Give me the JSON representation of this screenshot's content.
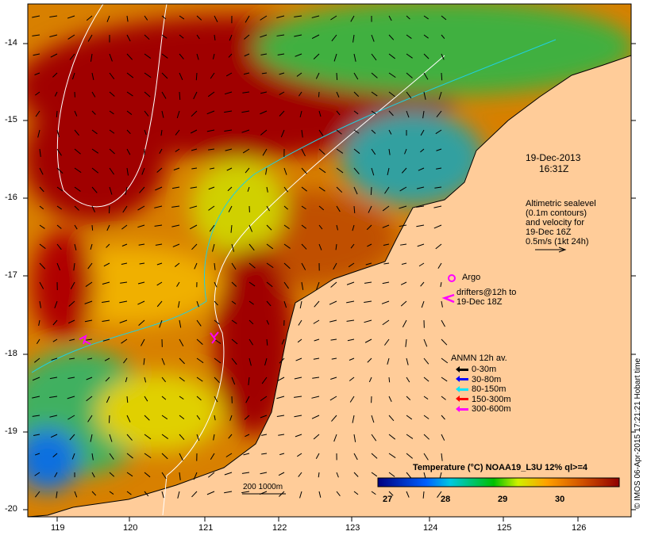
{
  "map": {
    "x_ticks": [
      "119",
      "120",
      "121",
      "122",
      "123",
      "124",
      "125",
      "126"
    ],
    "y_ticks": [
      "-14",
      "-15",
      "-16",
      "-17",
      "-18",
      "-19",
      "-20"
    ],
    "date": "19-Dec-2013",
    "time": "16:31Z",
    "altimetry": [
      "Altimetric sealevel",
      "(0.1m contours)",
      "and velocity for",
      "19-Dec 16Z",
      "0.5m/s (1kt 24h)"
    ],
    "argo_label": "Argo",
    "drifters_label": [
      "drifters@12h to",
      "19-Dec 18Z"
    ],
    "anmn_title": "ANMN 12h av.",
    "anmn_legend": [
      {
        "label": "0-30m",
        "color": "#000000"
      },
      {
        "label": "30-80m",
        "color": "#0000ff"
      },
      {
        "label": "80-150m",
        "color": "#00e5ff"
      },
      {
        "label": "150-300m",
        "color": "#ff0000"
      },
      {
        "label": "300-600m",
        "color": "#ff00ff"
      }
    ],
    "isobath_label": "200  1000m",
    "colorbar": {
      "title": "Temperature (°C) NOAA19_L3U 12% ql>=4",
      "ticks": [
        "27",
        "28",
        "29",
        "30"
      ],
      "range": [
        26.8,
        31.0
      ],
      "colors": [
        "#000080",
        "#0050ff",
        "#00c8e0",
        "#00c000",
        "#e0f000",
        "#ffa000",
        "#d05000",
        "#900000"
      ]
    },
    "credit": "© IMOS 06-Apr-2015 17:21:21 Hobart time",
    "land_color": "#ffcc99"
  }
}
